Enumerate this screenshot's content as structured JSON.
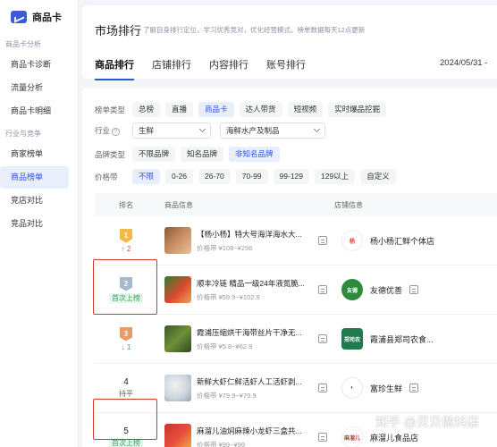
{
  "sidebar": {
    "brand": "商品卡",
    "groups": [
      {
        "title": "商品卡分析",
        "items": [
          "商品卡诊断",
          "流量分析",
          "商品卡明细"
        ]
      },
      {
        "title": "行业与竞争",
        "items": [
          "商家榜单",
          "商品榜单",
          "竞店对比",
          "竞品对比"
        ]
      }
    ]
  },
  "header": {
    "title": "市场排行",
    "description": "了解自身排行定位，学习优秀竞对，优化经营模式。榜单数据每天12点更新",
    "tabs": [
      "商品排行",
      "店铺排行",
      "内容排行",
      "账号排行"
    ],
    "date": "2024/05/31 -"
  },
  "filters": {
    "list_type_label": "榜单类型",
    "list_types": [
      "总榜",
      "直播",
      "商品卡",
      "达人带货",
      "短视频",
      "实时爆品挖掘"
    ],
    "industry_label": "行业",
    "industry_primary": "生鲜",
    "industry_secondary": "海鲜水产及制品",
    "brand_type_label": "品牌类型",
    "brand_types": [
      "不限品牌",
      "知名品牌",
      "非知名品牌"
    ],
    "price_label": "价格带",
    "price_ranges": [
      "不限",
      "0-26",
      "26-70",
      "70-99",
      "99-129",
      "129以上",
      "自定义"
    ]
  },
  "table": {
    "headers": {
      "rank": "排名",
      "product": "商品信息",
      "shop": "店铺信息"
    },
    "rows": [
      {
        "rank": "1",
        "trend": "↑ 2",
        "title": "【杨小杨】特大号海洋海水大...",
        "price": "价格带 ¥108~¥256",
        "shop": "杨小杨汇鲜个体店"
      },
      {
        "rank": "2",
        "trend": "首次上榜",
        "title": "顺丰冷链 精品一级24年液氮脆...",
        "price": "价格带 ¥59.9~¥102.9",
        "shop": "友德优善"
      },
      {
        "rank": "3",
        "trend": "↓ 1",
        "title": "霞浦压缩烘干海带丝片干净无...",
        "price": "价格带 ¥5.8~¥62.9",
        "shop": "霞浦县郑司农食..."
      },
      {
        "rank": "4",
        "trend": "持平",
        "title": "新鲜大虾仁鲜活虾人工活虾剥...",
        "price": "价格带 ¥79.9~¥79.9",
        "shop": "富珍生鲜"
      },
      {
        "rank": "5",
        "trend": "首次上榜",
        "title": "麻溜儿油焖麻辣小龙虾三盒共...",
        "price": "价格带 ¥99~¥99",
        "shop": "麻溜儿食品店"
      }
    ]
  },
  "watermark": "知乎 @贝贝做抖店",
  "colors": {
    "accent": "#2d54e5",
    "highlight": "#d6382c",
    "up": "#e35a3c",
    "down": "#3aa35b"
  }
}
